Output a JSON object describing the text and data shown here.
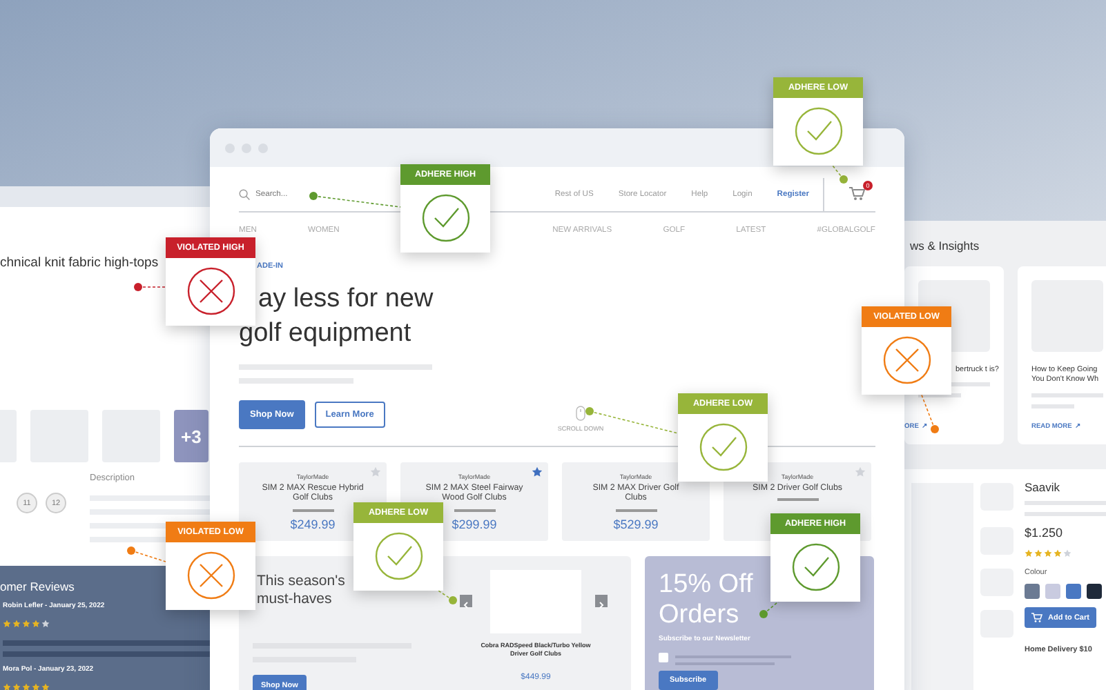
{
  "left_page": {
    "product_title": "chnical knit fabric high-tops",
    "more_photos": "+3",
    "sizes": [
      "11",
      "12"
    ],
    "description_label": "Description",
    "reviews_title": "omer Reviews",
    "reviews": [
      {
        "author": "Robin Lefler - January 25, 2022",
        "stars": 4
      },
      {
        "author": "Mora Pol - January 23, 2022",
        "stars": 5
      }
    ]
  },
  "main_window": {
    "search": {
      "placeholder": "Search..."
    },
    "top_links": [
      "Rest of US",
      "Store Locator",
      "Help",
      "Login"
    ],
    "register": "Register",
    "cart_count": "0",
    "nav": [
      "MEN",
      "WOMEN",
      "NEW ARRIVALS",
      "GOLF",
      "LATEST",
      "#GLOBALGOLF"
    ],
    "hero": {
      "eyebrow": "ADE-IN",
      "title_line_1": "ay less for new",
      "title_line_2": "golf equipment",
      "buttons": [
        "Shop Now",
        "Learn More"
      ],
      "scroll_hint": "SCROLL DOWN"
    },
    "products": [
      {
        "brand": "TaylorMade",
        "name": "SIM 2 MAX Rescue Hybrid Golf Clubs",
        "price": "$249.99",
        "favorite": false
      },
      {
        "brand": "TaylorMade",
        "name": "SIM 2 MAX Steel Fairway Wood Golf Clubs",
        "price": "$299.99",
        "favorite": true
      },
      {
        "brand": "TaylorMade",
        "name": "SIM 2 MAX Driver Golf Clubs",
        "price": "$529.99"
      },
      {
        "brand": "TaylorMade",
        "name": "SIM 2 Driver Golf Clubs",
        "favorite": false
      }
    ],
    "season": {
      "title": "This season's must-haves",
      "button": "Shop Now",
      "item_name": "Cobra RADSpeed Black/Turbo Yellow Driver Golf Clubs",
      "item_price": "$449.99"
    },
    "promo": {
      "title": "15% Off Orders",
      "subtitle": "Subscribe to our Newsletter",
      "checked": false,
      "button": "Subscribe"
    }
  },
  "right_page": {
    "section_title": "ws & Insights",
    "articles": [
      {
        "title": "bertruck t is?",
        "link": "ORE",
        "link_icon": "↗"
      },
      {
        "title": "How to Keep Going You Don't Know Wh",
        "link": "READ MORE",
        "link_icon": "↗"
      }
    ],
    "product": {
      "name": "Saavik",
      "price": "$1.250",
      "stars": 4,
      "colour_label": "Colour",
      "swatches": [
        {
          "color": "#6b7a93"
        },
        {
          "color": "#c9cbe0"
        },
        {
          "color": "#4a78c2"
        },
        {
          "color": "#1f2a3a"
        }
      ],
      "button": "Add to Cart",
      "delivery": "Home Delivery $10"
    }
  },
  "callouts": [
    {
      "label": "ADHERE HIGH",
      "kind": "adhere",
      "color": "#5e9a2e"
    },
    {
      "label": "ADHERE LOW",
      "kind": "adhere",
      "color": "#97b53a"
    },
    {
      "label": "VIOLATED HIGH",
      "kind": "violated",
      "color": "#c8202b"
    },
    {
      "label": "VIOLATED LOW",
      "kind": "violated",
      "color": "#f07c14"
    },
    {
      "label": "ADHERE LOW",
      "kind": "adhere",
      "color": "#97b53a"
    },
    {
      "label": "VIOLATED LOW",
      "kind": "violated",
      "color": "#f07c14"
    },
    {
      "label": "ADHERE LOW",
      "kind": "adhere",
      "color": "#97b53a"
    },
    {
      "label": "ADHERE HIGH",
      "kind": "adhere",
      "color": "#5e9a2e"
    }
  ]
}
